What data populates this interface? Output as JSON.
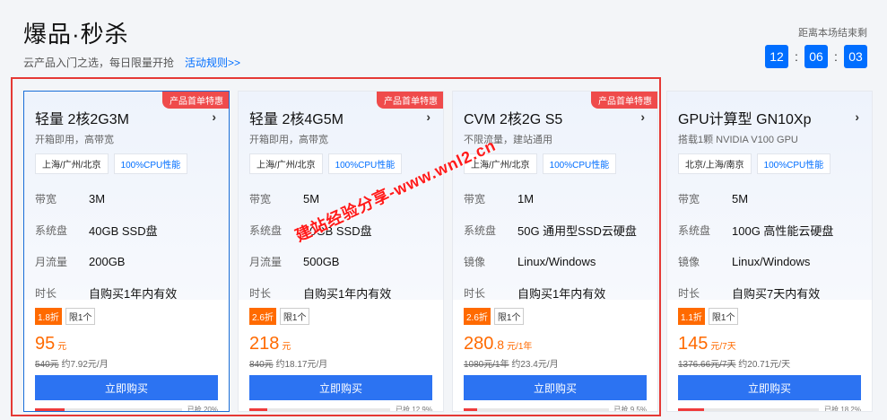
{
  "header": {
    "title": "爆品·秒杀",
    "subtitle": "云产品入门之选，每日限量开抢",
    "rules_link": "活动规则>>"
  },
  "countdown": {
    "label": "距离本场结束剩",
    "hours": "12",
    "minutes": "06",
    "seconds": "03",
    "sep": ":"
  },
  "watermark": "建站经验分享-www.wnl2.cn",
  "cards": [
    {
      "name": "轻量 2核2G3M",
      "desc": "开箱即用，高带宽",
      "promo": "产品首单特惠",
      "chips": [
        "上海/广州/北京",
        "100%CPU性能"
      ],
      "specs": [
        {
          "k": "带宽",
          "v": "3M"
        },
        {
          "k": "系统盘",
          "v": "40GB SSD盘"
        },
        {
          "k": "月流量",
          "v": "200GB"
        },
        {
          "k": "时长",
          "v": "自购买1年内有效"
        }
      ],
      "discount": "1.8折",
      "limit": "限1个",
      "price": "95",
      "price_unit": "元",
      "orig_price": "540元",
      "orig_per": "约7.92元/月",
      "buy": "立即购买",
      "sold_text": "已抢 20%",
      "sold_fraction": 0.2
    },
    {
      "name": "轻量 2核4G5M",
      "desc": "开箱即用，高带宽",
      "promo": "产品首单特惠",
      "chips": [
        "上海/广州/北京",
        "100%CPU性能"
      ],
      "specs": [
        {
          "k": "带宽",
          "v": "5M"
        },
        {
          "k": "系统盘",
          "v": "60GB SSD盘"
        },
        {
          "k": "月流量",
          "v": "500GB"
        },
        {
          "k": "时长",
          "v": "自购买1年内有效"
        }
      ],
      "discount": "2.6折",
      "limit": "限1个",
      "price": "218",
      "price_unit": "元",
      "orig_price": "840元",
      "orig_per": "约18.17元/月",
      "buy": "立即购买",
      "sold_text": "已抢 12.9%",
      "sold_fraction": 0.129
    },
    {
      "name": "CVM 2核2G S5",
      "desc": "不限流量，建站通用",
      "promo": "产品首单特惠",
      "chips": [
        "上海/广州/北京",
        "100%CPU性能"
      ],
      "specs": [
        {
          "k": "带宽",
          "v": "1M"
        },
        {
          "k": "系统盘",
          "v": "50G 通用型SSD云硬盘"
        },
        {
          "k": "镜像",
          "v": "Linux/Windows"
        },
        {
          "k": "时长",
          "v": "自购买1年内有效"
        }
      ],
      "discount": "2.6折",
      "limit": "限1个",
      "price": "280",
      "price_decimal": ".8",
      "price_unit": "元/1年",
      "orig_price": "1080元/1年",
      "orig_per": "约23.4元/月",
      "buy": "立即购买",
      "sold_text": "已抢 9.5%",
      "sold_fraction": 0.095
    },
    {
      "name": "GPU计算型 GN10Xp",
      "desc": "搭载1颗 NVIDIA V100 GPU",
      "promo": "",
      "chips": [
        "北京/上海/南京",
        "100%CPU性能"
      ],
      "specs": [
        {
          "k": "带宽",
          "v": "5M"
        },
        {
          "k": "系统盘",
          "v": "100G 高性能云硬盘"
        },
        {
          "k": "镜像",
          "v": "Linux/Windows"
        },
        {
          "k": "时长",
          "v": "自购买7天内有效"
        }
      ],
      "discount": "1.1折",
      "limit": "限1个",
      "price": "145",
      "price_unit": "元/7天",
      "orig_price": "1376.66元/7天",
      "orig_per": "约20.71元/天",
      "buy": "立即购买",
      "sold_text": "已抢 18.2%",
      "sold_fraction": 0.182
    }
  ]
}
